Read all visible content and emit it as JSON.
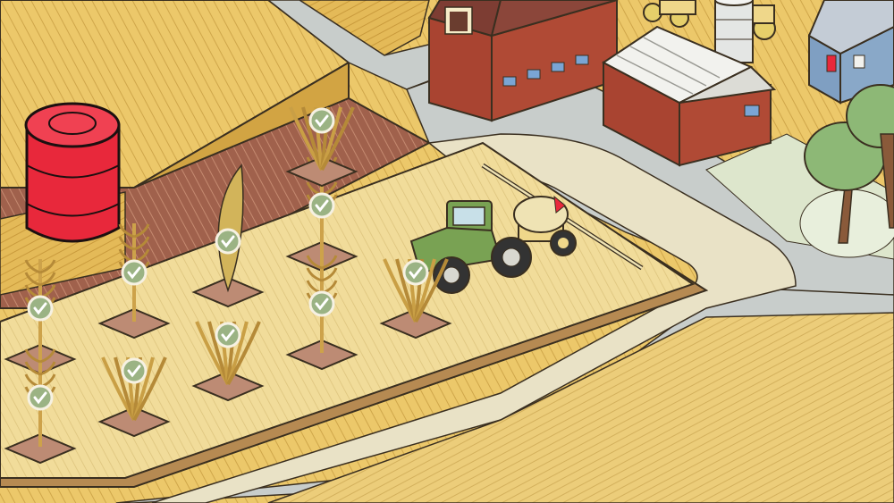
{
  "scene": {
    "colors": {
      "wheat_field": "#ecc86a",
      "wheat_field_dark": "#d9ae4c",
      "plowed_soil": "#a0614c",
      "test_plot": "#f1dc9a",
      "road_gray": "#c8cdcb",
      "sidewalk_cream": "#e9e2c6",
      "lawn": "#dde6cc",
      "barn_red": "#b04a35",
      "barn_roof": "#7d3d33",
      "shed_roof": "#f2f2ee",
      "house_blue": "#89a8c8",
      "tractor_green": "#79a253",
      "tank_cream": "#efe3b4",
      "barrel_red": "#e8283b",
      "check_badge": "#9bb384",
      "plant_mat": "#bd8b74",
      "tree_green": "#8db876"
    },
    "barrel_icon": "red-barrel",
    "check_icon": "checkmark",
    "plant_icon": "crop-plant",
    "tractor_icon": "tractor-with-sprayer",
    "plants": [
      {
        "name": "wheat-plant-1",
        "kind": "wheat"
      },
      {
        "name": "corn-plant-1",
        "kind": "corn"
      },
      {
        "name": "sorghum-plant-1",
        "kind": "sorghum"
      },
      {
        "name": "corn-plant-2",
        "kind": "corn"
      },
      {
        "name": "corn-plant-3",
        "kind": "corn"
      },
      {
        "name": "bushy-plant-1",
        "kind": "bushy"
      },
      {
        "name": "corn-plant-4",
        "kind": "corn"
      },
      {
        "name": "bushy-plant-2",
        "kind": "bushy"
      },
      {
        "name": "bushy-plant-3",
        "kind": "bushy"
      },
      {
        "name": "bushy-plant-4",
        "kind": "bushy"
      }
    ]
  }
}
